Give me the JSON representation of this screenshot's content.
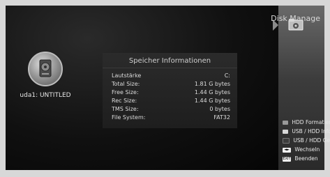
{
  "header": {
    "title": "Disk Manage"
  },
  "device": {
    "label": "uda1: UNTITLED"
  },
  "info_panel": {
    "title": "Speicher Informationen",
    "rows": [
      {
        "key": "Lautstärke",
        "value": "C:"
      },
      {
        "key": "Total Size:",
        "value": "1.81 G bytes"
      },
      {
        "key": "Free Size:",
        "value": "1.44 G bytes"
      },
      {
        "key": "Rec Size:",
        "value": "1.44 G bytes"
      },
      {
        "key": "TMS Size:",
        "value": "0 bytes"
      },
      {
        "key": "File System:",
        "value": "FAT32"
      }
    ]
  },
  "legend": {
    "items": [
      {
        "label": "HDD Formatier",
        "color": "#9a9a9a"
      },
      {
        "label": "USB / HDD Info",
        "color": "#d8d8d8"
      },
      {
        "label": "USB / HDD Gee",
        "color": "#3c3c3c"
      },
      {
        "label": "Wechseln",
        "button": "◄►"
      },
      {
        "label": "Beenden",
        "button": "EXIT"
      }
    ]
  },
  "icons": {
    "header": "folder-icon",
    "device": "hdd-icon"
  }
}
